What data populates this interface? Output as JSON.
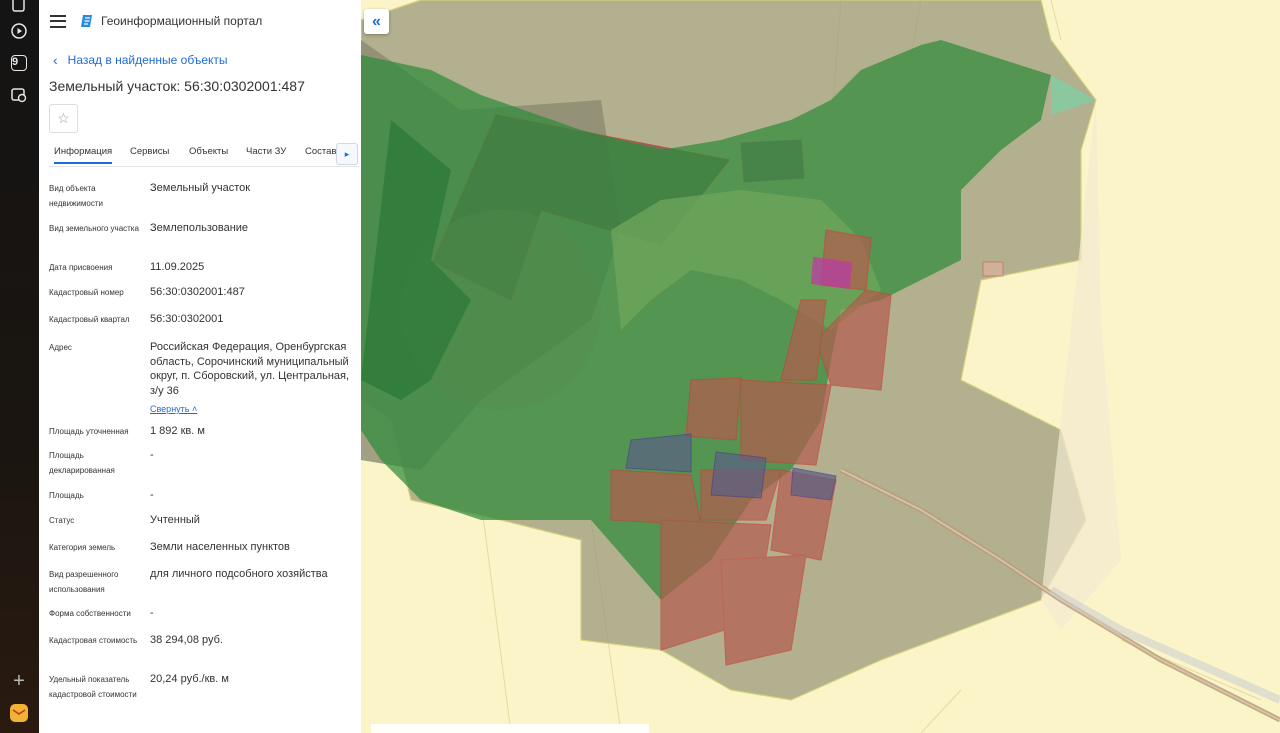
{
  "rail": {
    "badge": "9"
  },
  "header": {
    "title": "Геоинформационный портал"
  },
  "back_link": "Назад в найденные объекты",
  "object_title": "Земельный участок: 56:30:0302001:487",
  "tabs": [
    "Информация",
    "Сервисы",
    "Объекты",
    "Части ЗУ",
    "Состав"
  ],
  "fields": [
    {
      "label": "Вид объекта недвижимости",
      "value": "Земельный участок"
    },
    {
      "label": "Вид земельного участка",
      "value": "Землепользование"
    },
    {
      "label": "Дата присвоения",
      "value": "11.09.2025"
    },
    {
      "label": "Кадастровый номер",
      "value": "56:30:0302001:487"
    },
    {
      "label": "Кадастровый квартал",
      "value": "56:30:0302001"
    },
    {
      "label": "Адрес",
      "value": "Российская Федерация, Оренбургская область, Сорочинский муниципальный округ, п. Сборовский, ул. Центральная, з/у 36",
      "link": "Свернуть"
    },
    {
      "label": "Площадь уточненная",
      "value": "1 892 кв. м"
    },
    {
      "label": "Площадь декларированная",
      "value": "-"
    },
    {
      "label": "Площадь",
      "value": "-"
    },
    {
      "label": "Статус",
      "value": "Учтенный"
    },
    {
      "label": "Категория земель",
      "value": "Земли населенных пунктов"
    },
    {
      "label": "Вид разрешенного использования",
      "value": "для личного подсобного хозяйства"
    },
    {
      "label": "Форма собственности",
      "value": "-"
    },
    {
      "label": "Кадастровая стоимость",
      "value": "38 294,08 руб."
    },
    {
      "label": "Удельный показатель кадастровой стоимости",
      "value": "20,24 руб./кв. м"
    }
  ],
  "colors": {
    "accent": "#1e6bd6",
    "map_base": "#fbf4c9",
    "selected_parcel": "#c8389a"
  }
}
